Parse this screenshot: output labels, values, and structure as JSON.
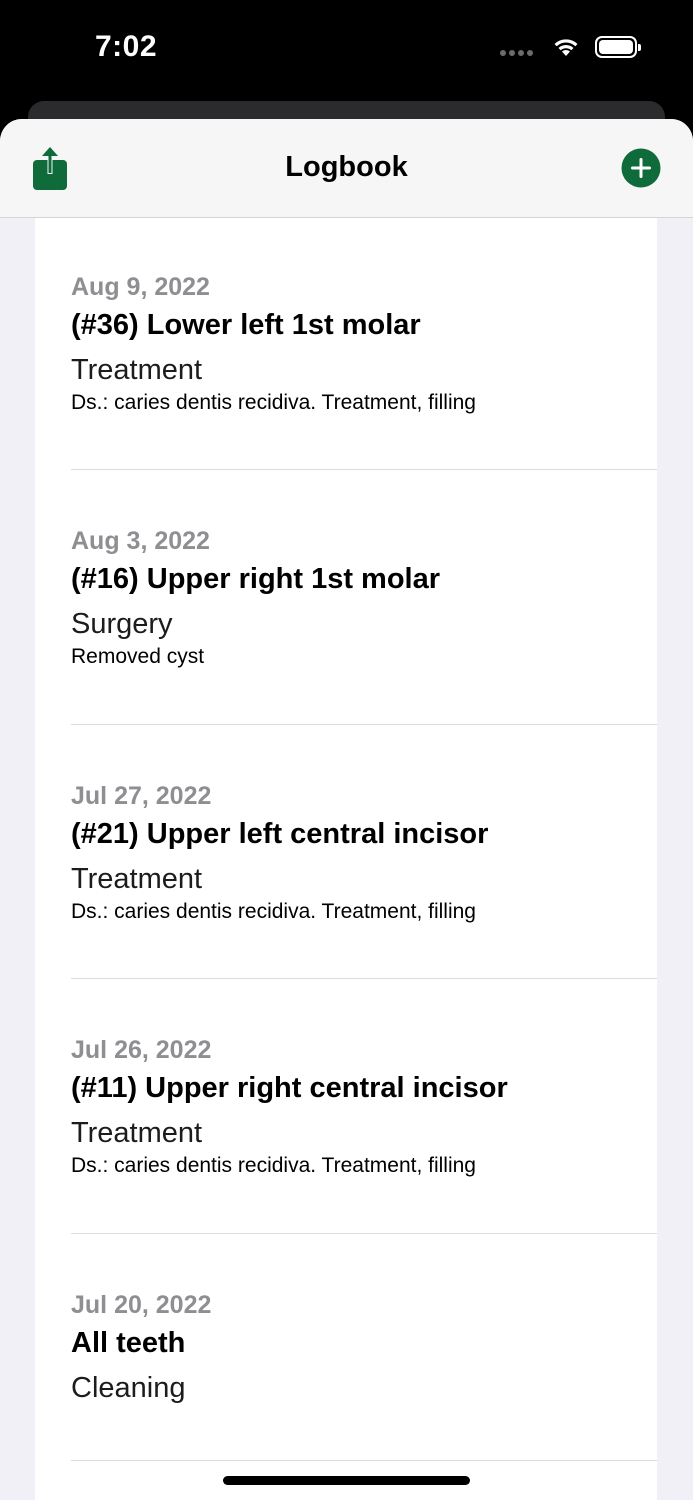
{
  "status_bar": {
    "time": "7:02"
  },
  "nav": {
    "title": "Logbook",
    "share_icon": "share-icon",
    "add_icon": "plus-circle-icon",
    "accent_color": "#0f6b3a"
  },
  "entries": [
    {
      "date": "Aug 9, 2022",
      "tooth": "(#36) Lower left 1st molar",
      "type": "Treatment",
      "note": "Ds.: caries dentis recidiva. Treatment, filling"
    },
    {
      "date": "Aug 3, 2022",
      "tooth": "(#16) Upper right 1st molar",
      "type": "Surgery",
      "note": "Removed cyst"
    },
    {
      "date": "Jul 27, 2022",
      "tooth": "(#21) Upper left central incisor",
      "type": "Treatment",
      "note": "Ds.: caries dentis recidiva. Treatment, filling"
    },
    {
      "date": "Jul 26, 2022",
      "tooth": "(#11) Upper right central incisor",
      "type": "Treatment",
      "note": "Ds.: caries dentis recidiva. Treatment, filling"
    },
    {
      "date": "Jul 20, 2022",
      "tooth": "All teeth",
      "type": "Cleaning",
      "note": ""
    }
  ]
}
